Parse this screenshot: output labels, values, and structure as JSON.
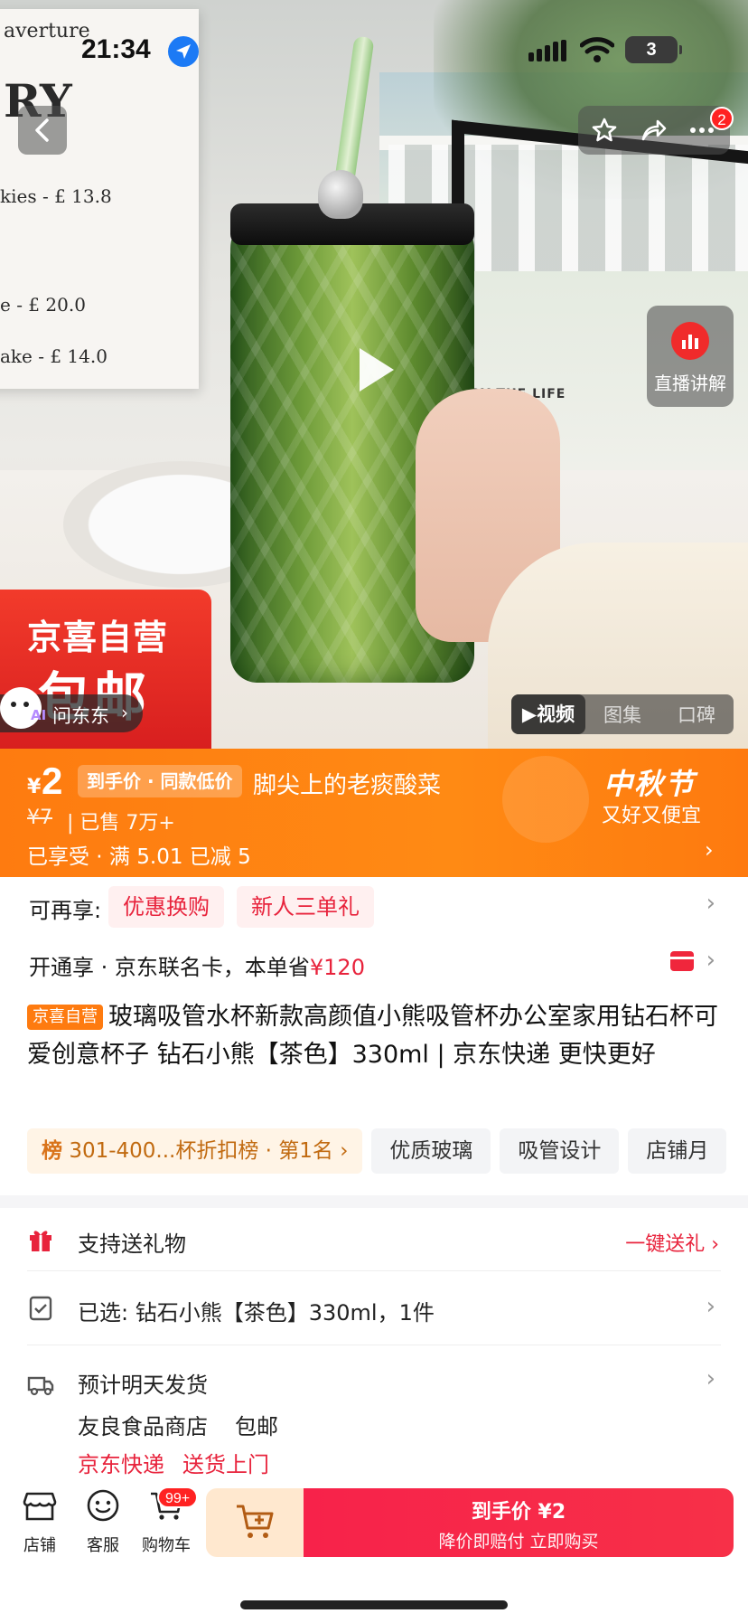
{
  "status_bar": {
    "time": "21:34",
    "battery": "3"
  },
  "top_nav": {
    "cart_badge": "2"
  },
  "hero": {
    "board_lines": [
      "averture",
      "RY",
      "kies - £ 13.8",
      "e - £ 20.0",
      "ake - £ 14.0"
    ],
    "frame_text": "OY THE LIFE",
    "live_label": "直播讲解",
    "promo_line1": "京喜自营",
    "promo_line2": "包邮",
    "ask_ai": "AI",
    "ask_label": "问东东",
    "ask_chevron": "›",
    "media_tabs": [
      "▶视频",
      "图集",
      "口碑"
    ]
  },
  "price": {
    "currency": "¥",
    "amount": "2",
    "tag": "到手价 · 同款低价",
    "slogan": "脚尖上的老痰酸菜",
    "original": "¥7",
    "sold": "| 已售 7万+",
    "enjoyed": "已享受 · 满 5.01 已减 5",
    "festival": "中秋节",
    "festival_sub": "又好又便宜"
  },
  "benefits": {
    "label": "可再享:",
    "chips": [
      "优惠换购",
      "新人三单礼"
    ]
  },
  "open_card": {
    "text": "开通享 · 京东联名卡，本单省",
    "amount": "¥120"
  },
  "product": {
    "self_tag": "京喜自营",
    "title": "玻璃吸管水杯新款高颜值小熊吸管杯办公室家用钻石杯可爱创意杯子 钻石小熊【茶色】330ml | 京东快递 更快更好"
  },
  "tags": {
    "rank_icon": "榜",
    "rank_text": "301-400...杯折扣榜 · 第1名 ›",
    "chips": [
      "优质玻璃",
      "吸管设计",
      "店铺月"
    ]
  },
  "gift": {
    "label": "支持送礼物",
    "action": "一键送礼 ›"
  },
  "selected": {
    "text": "已选:  钻石小熊【茶色】330ml，1件"
  },
  "shipping": {
    "title": "预计明天发货",
    "shop": "友良食品商店",
    "free": "包邮",
    "express": "京东快递",
    "door": "送货上门"
  },
  "bottom_bar": {
    "shop": "店铺",
    "service": "客服",
    "cart": "购物车",
    "cart_badge": "99+",
    "buy_line1": "到手价 ¥2",
    "buy_line2": "降价即赔付 立即购买"
  },
  "colors": {
    "accent_orange": "#fe7b10",
    "accent_red": "#e8233c",
    "buy_red": "#f7224a"
  }
}
